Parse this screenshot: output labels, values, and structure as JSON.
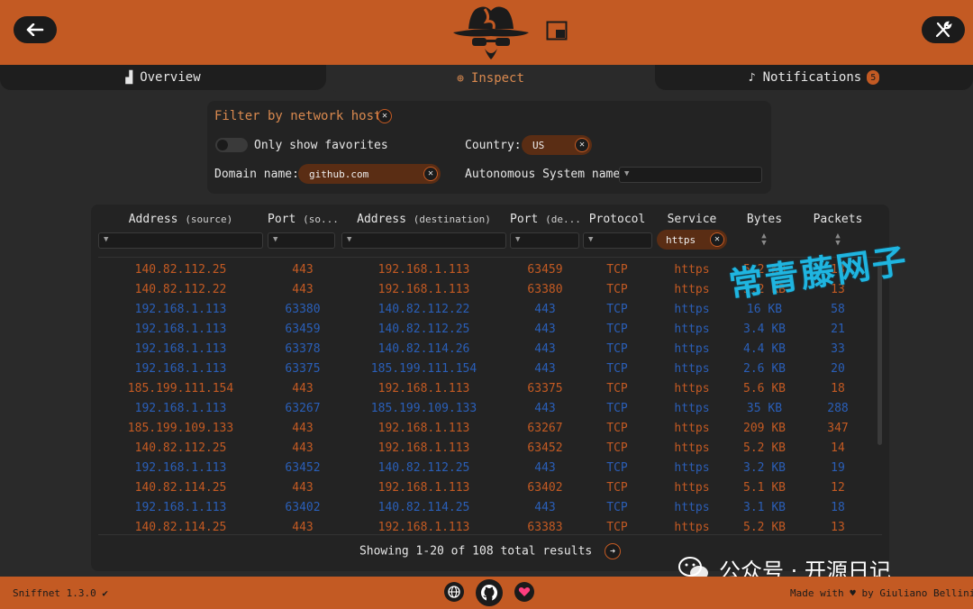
{
  "header": {
    "back_icon": "arrow-left-icon",
    "settings_icon": "wrench-screwdriver-icon",
    "logo_icon": "spy-hat-logo",
    "pip_icon": "picture-in-picture-icon",
    "accent_color": "#c35a23"
  },
  "tabs": [
    {
      "label": "Overview",
      "icon": "chart-icon"
    },
    {
      "label": "Inspect",
      "icon": "magnifier-icon"
    },
    {
      "label": "Notifications",
      "icon": "bell-icon",
      "badge": "5"
    }
  ],
  "filter": {
    "title": "Filter by network host",
    "favorites_label": "Only show favorites",
    "country_label": "Country:",
    "country_value": "US",
    "domain_label": "Domain name:",
    "domain_value": "github.com",
    "as_label": "Autonomous System name:"
  },
  "table": {
    "columns": [
      {
        "label": "Address",
        "sub": "(source)"
      },
      {
        "label": "Port",
        "sub": "(so..."
      },
      {
        "label": "Address",
        "sub": "(destination)"
      },
      {
        "label": "Port",
        "sub": "(de..."
      },
      {
        "label": "Protocol",
        "sub": ""
      },
      {
        "label": "Service",
        "sub": ""
      },
      {
        "label": "Bytes",
        "sub": ""
      },
      {
        "label": "Packets",
        "sub": ""
      }
    ],
    "service_filter": "https",
    "rows": [
      {
        "dir": "in",
        "src": "140.82.112.25",
        "sport": "443",
        "dst": "192.168.1.113",
        "dport": "63459",
        "proto": "TCP",
        "svc": "https",
        "bytes": "5.2 KB",
        "pkts": "13"
      },
      {
        "dir": "in",
        "src": "140.82.112.22",
        "sport": "443",
        "dst": "192.168.1.113",
        "dport": "63380",
        "proto": "TCP",
        "svc": "https",
        "bytes": "5.2 KB",
        "pkts": "13"
      },
      {
        "dir": "out",
        "src": "192.168.1.113",
        "sport": "63380",
        "dst": "140.82.112.22",
        "dport": "443",
        "proto": "TCP",
        "svc": "https",
        "bytes": "16 KB",
        "pkts": "58"
      },
      {
        "dir": "out",
        "src": "192.168.1.113",
        "sport": "63459",
        "dst": "140.82.112.25",
        "dport": "443",
        "proto": "TCP",
        "svc": "https",
        "bytes": "3.4 KB",
        "pkts": "21"
      },
      {
        "dir": "out",
        "src": "192.168.1.113",
        "sport": "63378",
        "dst": "140.82.114.26",
        "dport": "443",
        "proto": "TCP",
        "svc": "https",
        "bytes": "4.4 KB",
        "pkts": "33"
      },
      {
        "dir": "out",
        "src": "192.168.1.113",
        "sport": "63375",
        "dst": "185.199.111.154",
        "dport": "443",
        "proto": "TCP",
        "svc": "https",
        "bytes": "2.6 KB",
        "pkts": "20"
      },
      {
        "dir": "in",
        "src": "185.199.111.154",
        "sport": "443",
        "dst": "192.168.1.113",
        "dport": "63375",
        "proto": "TCP",
        "svc": "https",
        "bytes": "5.6 KB",
        "pkts": "18"
      },
      {
        "dir": "out",
        "src": "192.168.1.113",
        "sport": "63267",
        "dst": "185.199.109.133",
        "dport": "443",
        "proto": "TCP",
        "svc": "https",
        "bytes": "35 KB",
        "pkts": "288"
      },
      {
        "dir": "in",
        "src": "185.199.109.133",
        "sport": "443",
        "dst": "192.168.1.113",
        "dport": "63267",
        "proto": "TCP",
        "svc": "https",
        "bytes": "209 KB",
        "pkts": "347"
      },
      {
        "dir": "in",
        "src": "140.82.112.25",
        "sport": "443",
        "dst": "192.168.1.113",
        "dport": "63452",
        "proto": "TCP",
        "svc": "https",
        "bytes": "5.2 KB",
        "pkts": "14"
      },
      {
        "dir": "out",
        "src": "192.168.1.113",
        "sport": "63452",
        "dst": "140.82.112.25",
        "dport": "443",
        "proto": "TCP",
        "svc": "https",
        "bytes": "3.2 KB",
        "pkts": "19"
      },
      {
        "dir": "in",
        "src": "140.82.114.25",
        "sport": "443",
        "dst": "192.168.1.113",
        "dport": "63402",
        "proto": "TCP",
        "svc": "https",
        "bytes": "5.1 KB",
        "pkts": "12"
      },
      {
        "dir": "out",
        "src": "192.168.1.113",
        "sport": "63402",
        "dst": "140.82.114.25",
        "dport": "443",
        "proto": "TCP",
        "svc": "https",
        "bytes": "3.1 KB",
        "pkts": "18"
      },
      {
        "dir": "in",
        "src": "140.82.114.25",
        "sport": "443",
        "dst": "192.168.1.113",
        "dport": "63383",
        "proto": "TCP",
        "svc": "https",
        "bytes": "5.2 KB",
        "pkts": "13"
      }
    ],
    "results_text": "Showing 1-20 of 108 total results"
  },
  "overlay": {
    "watermark": "常青藤网子",
    "wechat": "公众号 · 开源日记"
  },
  "footer": {
    "version": "Sniffnet 1.3.0",
    "made_with": "Made with",
    "by": "by Giuliano Bellini",
    "icons": [
      "globe-icon",
      "github-icon",
      "heart-icon"
    ]
  }
}
